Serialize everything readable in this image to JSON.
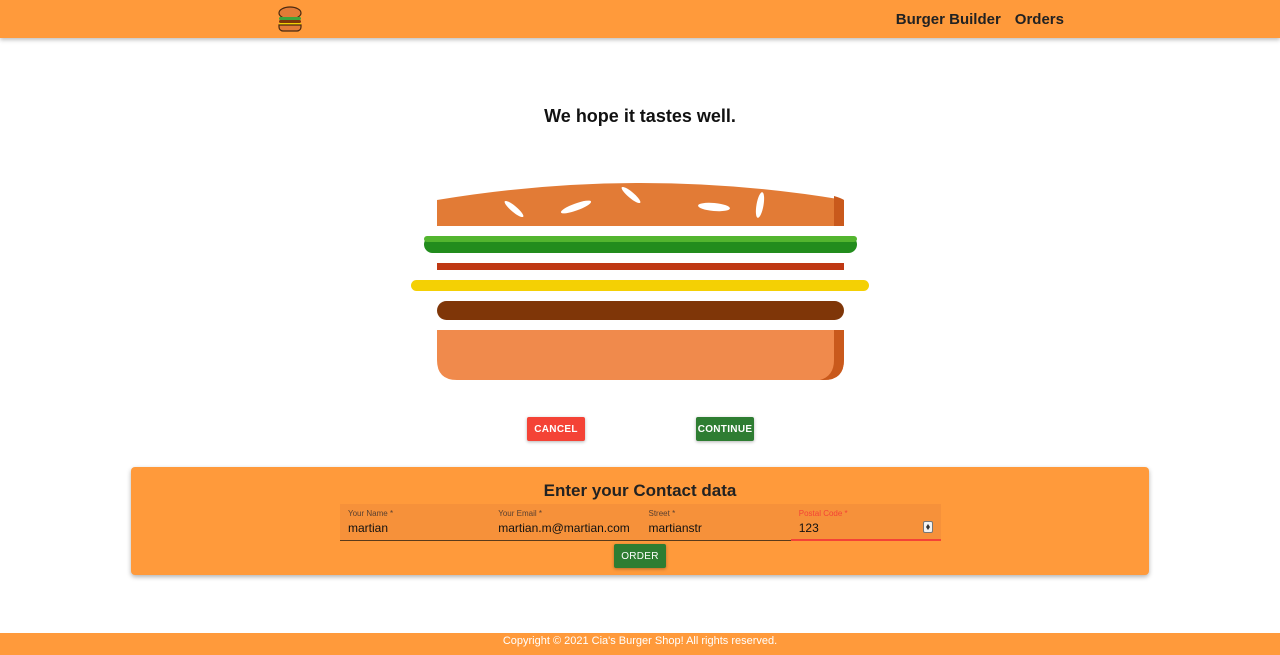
{
  "header": {
    "logo": "burger-logo",
    "nav": [
      {
        "label": "Burger Builder"
      },
      {
        "label": "Orders"
      }
    ]
  },
  "headline": "We hope it tastes well.",
  "burger": {
    "ingredients": [
      "bread-top",
      "salad",
      "bacon",
      "cheese",
      "meat",
      "bread-bottom"
    ],
    "colors": {
      "bread": "#e27b36",
      "salad": "#228c1d",
      "bacon": "#bf3813",
      "cheese": "#f4d004",
      "meat": "#7f3608"
    }
  },
  "actions": {
    "cancel": "CANCEL",
    "continue": "CONTINUE"
  },
  "contact": {
    "title": "Enter your Contact data",
    "fields": [
      {
        "label": "Your Name *",
        "value": "martian"
      },
      {
        "label": "Your Email *",
        "value": "martian.m@martian.com"
      },
      {
        "label": "Street *",
        "value": "martianstr"
      },
      {
        "label": "Postal Code *",
        "value": "123",
        "invalid": true
      }
    ],
    "order_button": "ORDER"
  },
  "footer": "Copyright © 2021  Cia's Burger Shop! All rights reserved.",
  "colors": {
    "toolbar": "#ff9a3b",
    "cancel": "#f44336",
    "success": "#2e7d32",
    "error": "#f44336"
  }
}
